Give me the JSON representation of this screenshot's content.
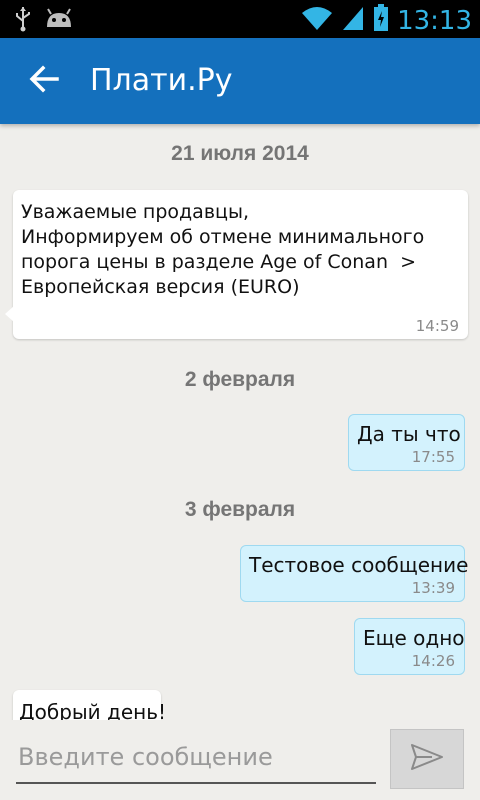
{
  "status_bar": {
    "time": "13:13",
    "icons": [
      "usb-icon",
      "android-icon",
      "wifi-icon",
      "signal-icon",
      "battery-icon"
    ],
    "time_color": "#33b5e5"
  },
  "app_bar": {
    "title": "Плати.Ру",
    "back_icon": "arrow-left-icon",
    "color": "#1470bd"
  },
  "messages": [
    {
      "type": "date",
      "label": "21 июля 2014"
    },
    {
      "type": "incoming",
      "text": "Уважаемые продавцы,\nИнформируем об отмене минимального\nпорога цены в разделе Age of Conan  >\nЕвропейская версия (EURO)",
      "time": "14:59"
    },
    {
      "type": "date",
      "label": "2 февраля"
    },
    {
      "type": "outgoing",
      "text": "Да ты что",
      "time": "17:55"
    },
    {
      "type": "date",
      "label": "3 февраля"
    },
    {
      "type": "outgoing",
      "text": "Тестовое сообщение",
      "time": "13:39"
    },
    {
      "type": "outgoing",
      "text": "Еще одно",
      "time": "14:26"
    },
    {
      "type": "incoming",
      "text": "Добрый день!",
      "time": ""
    }
  ],
  "composer": {
    "placeholder": "Введите сообщение",
    "value": "",
    "send_icon": "send-icon"
  }
}
